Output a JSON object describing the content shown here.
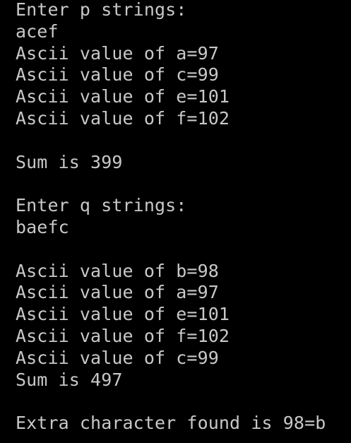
{
  "colors": {
    "background": "#000000",
    "text": "#c8c8c8"
  },
  "console": {
    "lines": [
      "Enter p strings:",
      "acef",
      "Ascii value of a=97",
      "Ascii value of c=99",
      "Ascii value of e=101",
      "Ascii value of f=102",
      "",
      "Sum is 399",
      "",
      "Enter q strings:",
      "baefc",
      "",
      "Ascii value of b=98",
      "Ascii value of a=97",
      "Ascii value of e=101",
      "Ascii value of f=102",
      "Ascii value of c=99",
      "Sum is 497",
      "",
      "Extra character found is 98=b"
    ]
  }
}
